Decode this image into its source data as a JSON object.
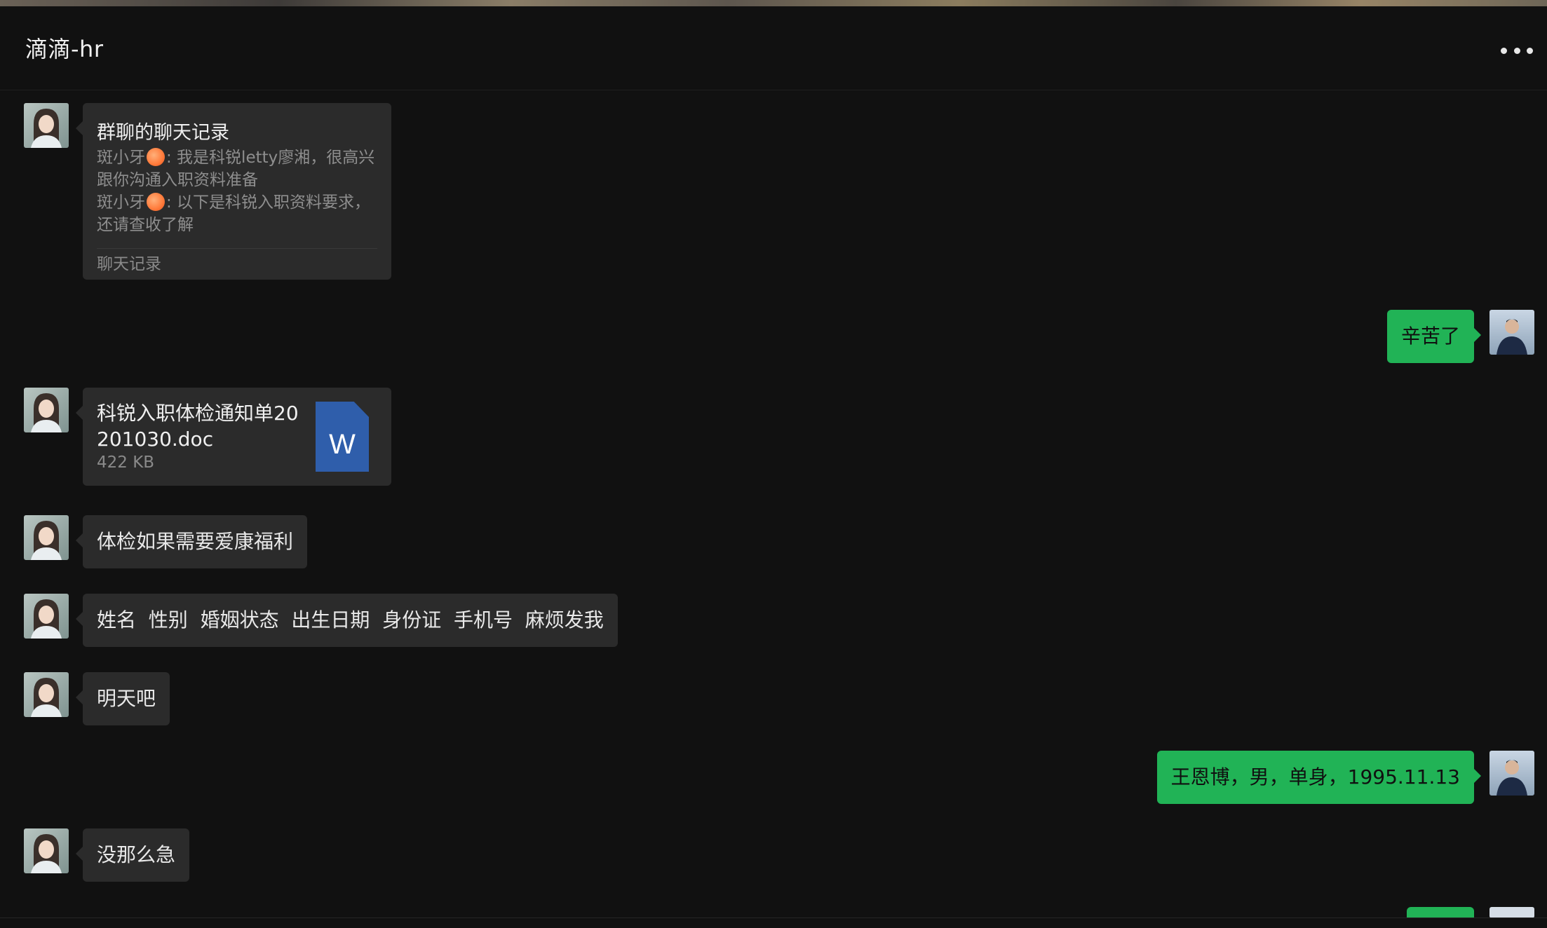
{
  "window": {
    "title": "滴滴-hr",
    "more_icon": "more-dots-icon"
  },
  "messages": [
    {
      "type": "chat-record",
      "sender": "hr",
      "title": "群聊的聊天记录",
      "lines": [
        {
          "name": "斑小牙",
          "text": ": 我是科锐letty廖湘，很高兴跟你沟通入职资料准备"
        },
        {
          "name": "斑小牙",
          "text": ": 以下是科锐入职资料要求，还请查收了解"
        }
      ],
      "footer": "聊天记录"
    },
    {
      "type": "text",
      "sender": "me",
      "text": "辛苦了"
    },
    {
      "type": "file",
      "sender": "hr",
      "name": "科锐入职体检通知单20201030.doc",
      "size": "422 KB",
      "icon": "word-doc-icon"
    },
    {
      "type": "text",
      "sender": "hr",
      "text": "体检如果需要爱康福利"
    },
    {
      "type": "text",
      "sender": "hr",
      "text": "姓名  性别  婚姻状态  出生日期  身份证  手机号  麻烦发我"
    },
    {
      "type": "text",
      "sender": "hr",
      "text": "明天吧"
    },
    {
      "type": "text",
      "sender": "me",
      "text": "王恩博，男，单身，1995.11.13"
    },
    {
      "type": "text",
      "sender": "hr",
      "text": "没那么急"
    }
  ],
  "colors": {
    "background": "#111111",
    "incoming_bubble": "#2b2b2b",
    "outgoing_bubble": "#21b356"
  }
}
